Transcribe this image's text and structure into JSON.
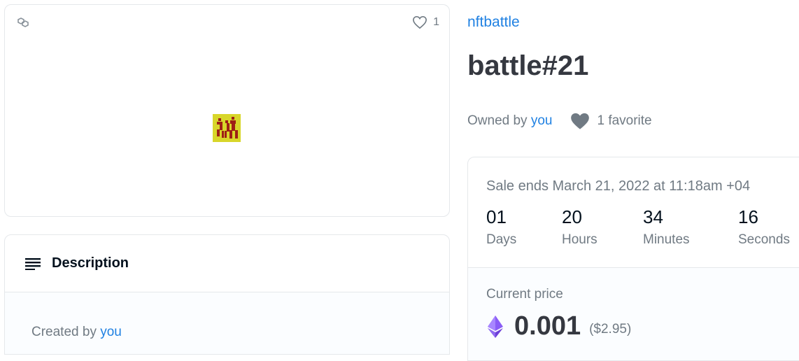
{
  "media": {
    "favorite_count": "1",
    "image_colors": {
      "background": "#d8d62a",
      "figure": "#9e2016"
    }
  },
  "description": {
    "title": "Description",
    "created_prefix": "Created by",
    "created_by": "you"
  },
  "item": {
    "collection": "nftbattle",
    "title": "battle#21",
    "owned_prefix": "Owned by",
    "owner": "you",
    "favorites_label": "1 favorite"
  },
  "sale": {
    "ends_text": "Sale ends March 21, 2022 at 11:18am +04",
    "countdown": [
      {
        "value": "01",
        "unit": "Days"
      },
      {
        "value": "20",
        "unit": "Hours"
      },
      {
        "value": "34",
        "unit": "Minutes"
      },
      {
        "value": "16",
        "unit": "Seconds"
      }
    ],
    "price_label": "Current price",
    "price": "0.001",
    "price_usd": "($2.95)"
  },
  "icons": {
    "chain": "polygon-chain-icon",
    "favorite": "heart-outline-icon",
    "favorites": "heart-filled-icon",
    "description": "text-lines-icon",
    "currency": "ethereum-icon"
  },
  "colors": {
    "link": "#2081e2",
    "text": "#353840",
    "muted": "#707a83",
    "border": "#e5e8eb"
  }
}
